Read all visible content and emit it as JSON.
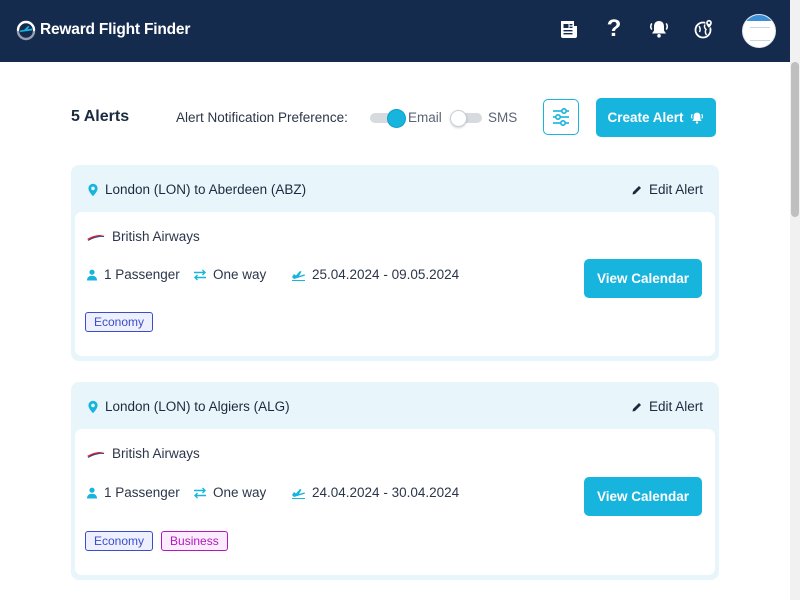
{
  "app": {
    "title": "Reward Flight Finder"
  },
  "nav": {
    "icons": [
      "newspaper-icon",
      "help-icon",
      "bell-icon",
      "globe-location-icon"
    ],
    "help_glyph": "?"
  },
  "toolbar": {
    "alerts_count": "5 Alerts",
    "preference_label": "Alert Notification Preference:",
    "email_label": "Email",
    "sms_label": "SMS",
    "email_enabled": true,
    "sms_enabled": false,
    "create_alert_label": "Create Alert"
  },
  "alerts": [
    {
      "route": "London (LON) to Aberdeen (ABZ)",
      "edit_label": "Edit Alert",
      "airline": "British Airways",
      "passengers": "1 Passenger",
      "trip_type": "One way",
      "date_range": "25.04.2024 - 09.05.2024",
      "view_calendar_label": "View Calendar",
      "cabins": [
        "Economy"
      ]
    },
    {
      "route": "London (LON) to Algiers (ALG)",
      "edit_label": "Edit Alert",
      "airline": "British Airways",
      "passengers": "1 Passenger",
      "trip_type": "One way",
      "date_range": "24.04.2024 - 30.04.2024",
      "view_calendar_label": "View Calendar",
      "cabins": [
        "Economy",
        "Business"
      ]
    }
  ],
  "colors": {
    "navbar": "#152b4e",
    "accent": "#17b4dd",
    "card_background": "#e8f6fb",
    "economy_tag": "#3a4ec9",
    "business_tag": "#b218bd"
  }
}
